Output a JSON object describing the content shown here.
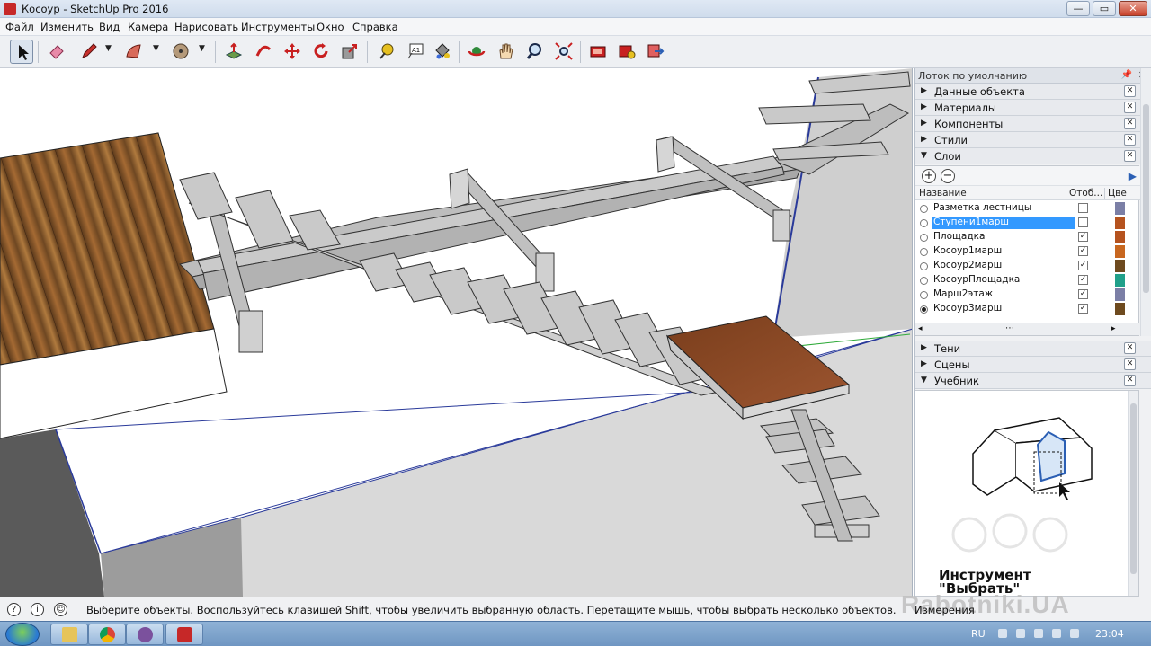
{
  "window": {
    "title": "Косоур - SketchUp Pro 2016",
    "minimize": "—",
    "maximize": "▭",
    "close": "✕"
  },
  "menu": [
    "Файл",
    "Изменить",
    "Вид",
    "Камера",
    "Нарисовать",
    "Инструменты",
    "Окно",
    "Справка"
  ],
  "toolbar": {
    "icons": [
      "select-tool",
      "eraser-tool",
      "pencil-tool",
      "arc-tool",
      "shape-tool",
      "pushpull-tool",
      "followme-tool",
      "move-tool",
      "rotate-tool",
      "scale-tool",
      "tape-measure-tool",
      "text-tool",
      "paint-bucket-tool",
      "orbit-tool",
      "pan-tool",
      "zoom-tool",
      "zoom-extents-tool",
      "warehouse-tool",
      "extension-warehouse-tool",
      "send-to-layout-tool"
    ],
    "text_tool_label": "A1"
  },
  "tray": {
    "title": "Лоток по умолчанию",
    "panels_top": [
      {
        "label": "Данные объекта",
        "expanded": false
      },
      {
        "label": "Материалы",
        "expanded": false
      },
      {
        "label": "Компоненты",
        "expanded": false
      },
      {
        "label": "Стили",
        "expanded": false
      },
      {
        "label": "Слои",
        "expanded": true
      }
    ],
    "layers": {
      "columns": {
        "name": "Название",
        "visible": "Отоб...",
        "color": "Цве"
      },
      "rows": [
        {
          "name": "Разметка лестницы",
          "active": false,
          "visible": false,
          "color": "#7b7fa6",
          "selected": false
        },
        {
          "name": "Ступени1марш",
          "active": false,
          "visible": false,
          "color": "#b5531f",
          "selected": true
        },
        {
          "name": "Площадка",
          "active": false,
          "visible": true,
          "color": "#b5531f",
          "selected": false
        },
        {
          "name": "Косоур1марш",
          "active": false,
          "visible": true,
          "color": "#c8671f",
          "selected": false
        },
        {
          "name": "Косоур2марш",
          "active": false,
          "visible": true,
          "color": "#6e4a1f",
          "selected": false
        },
        {
          "name": "КосоурПлощадка",
          "active": false,
          "visible": true,
          "color": "#21a08a",
          "selected": false
        },
        {
          "name": "Марш2этаж",
          "active": false,
          "visible": true,
          "color": "#7b7fa6",
          "selected": false
        },
        {
          "name": "Косоур3марш",
          "active": true,
          "visible": true,
          "color": "#6e4a1f",
          "selected": false
        }
      ]
    },
    "panels_bottom": [
      {
        "label": "Тени",
        "expanded": false
      },
      {
        "label": "Сцены",
        "expanded": false
      },
      {
        "label": "Учебник",
        "expanded": true
      }
    ],
    "tutorial": {
      "title_line1": "Инструмент",
      "title_line2": "\"Выбрать\""
    }
  },
  "status": {
    "text": "Выберите объекты. Воспользуйтесь клавишей Shift, чтобы увеличить выбранную область. Перетащите мышь, чтобы выбрать несколько объектов.",
    "measurements_label": "Измерения",
    "watermark": "Rabotniki.UA"
  },
  "taskbar": {
    "language": "RU",
    "time": "23:04",
    "apps": [
      "explorer",
      "chrome",
      "viber",
      "sketchup"
    ]
  }
}
